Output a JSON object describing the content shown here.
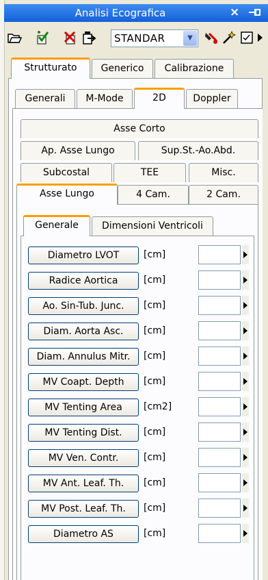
{
  "window": {
    "title": "Analisi Ecografica",
    "close_glyph": "×"
  },
  "toolbar": {
    "preset_value": "STANDAR"
  },
  "main_tabs": [
    "Strutturato",
    "Generico",
    "Calibrazione"
  ],
  "view_tabs": [
    "Generali",
    "M-Mode",
    "2D",
    "Doppler"
  ],
  "subview_tabs": {
    "row1": [
      "Asse Corto"
    ],
    "row2": [
      "Ap. Asse Lungo",
      "Sup.St.-Ao.Abd."
    ],
    "row3": [
      "Subcostal",
      "TEE",
      "Misc."
    ],
    "row4": [
      "Asse Lungo",
      "4 Cam.",
      "2 Cam."
    ]
  },
  "section_tabs": [
    "Generale",
    "Dimensioni Ventricoli"
  ],
  "measurements": [
    {
      "label": "Diametro LVOT",
      "unit": "[cm]"
    },
    {
      "label": "Radice Aortica",
      "unit": "[cm]"
    },
    {
      "label": "Ao. Sin-Tub. Junc.",
      "unit": "[cm]"
    },
    {
      "label": "Diam. Aorta Asc.",
      "unit": "[cm]"
    },
    {
      "label": "Diam. Annulus Mitr.",
      "unit": "[cm]"
    },
    {
      "label": "MV Coapt. Depth",
      "unit": "[cm]"
    },
    {
      "label": "MV Tenting Area",
      "unit": "[cm2]"
    },
    {
      "label": "MV Tenting Dist.",
      "unit": "[cm]"
    },
    {
      "label": "MV Ven. Contr.",
      "unit": "[cm]"
    },
    {
      "label": "MV Ant. Leaf. Th.",
      "unit": "[cm]"
    },
    {
      "label": "MV Post. Leaf. Th.",
      "unit": "[cm]"
    },
    {
      "label": "Diametro AS",
      "unit": "[cm]"
    }
  ],
  "icons": [
    "open-folder-icon",
    "check-add-icon",
    "delete-red-icon",
    "export-icon",
    "bone-tool-icon",
    "wand-icon",
    "checklist-icon",
    "more-arrow-icon"
  ],
  "colors": {
    "title_bar": "#1e6ee6",
    "selected_tab_accent": "#ff9c00",
    "window_bg": "#ece9d8"
  }
}
